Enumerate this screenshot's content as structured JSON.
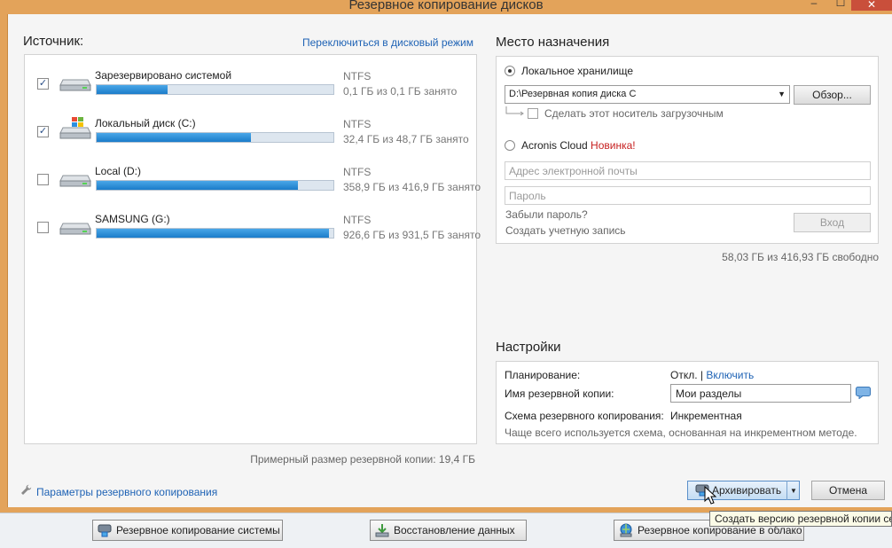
{
  "window": {
    "title": "Резервное копирование дисков",
    "min_glyph": "–",
    "max_glyph": "☐",
    "close_glyph": "✕"
  },
  "source": {
    "heading": "Источник:",
    "switch_link": "Переключиться в дисковый режим",
    "disks": [
      {
        "name": "Зарезервировано системой",
        "fs": "NTFS",
        "usage": "0,1 ГБ из 0,1 ГБ занято",
        "checked": true,
        "fill": 0.3,
        "icon": "hdd-icon"
      },
      {
        "name": "Локальный диск (C:)",
        "fs": "NTFS",
        "usage": "32,4 ГБ из 48,7 ГБ занято",
        "checked": true,
        "fill": 0.65,
        "icon": "windows-hdd-icon"
      },
      {
        "name": "Local (D:)",
        "fs": "NTFS",
        "usage": "358,9 ГБ из 416,9 ГБ занято",
        "checked": false,
        "fill": 0.85,
        "icon": "hdd-icon"
      },
      {
        "name": "SAMSUNG (G:)",
        "fs": "NTFS",
        "usage": "926,6 ГБ из 931,5 ГБ занято",
        "checked": false,
        "fill": 0.98,
        "icon": "hdd-icon"
      }
    ],
    "estimated_size": "Примерный размер резервной копии: 19,4 ГБ"
  },
  "destination": {
    "heading": "Место назначения",
    "local_label": "Локальное хранилище",
    "path_value": "D:\\Резервная копия диска C",
    "browse_label": "Обзор...",
    "bootable_label": "Сделать этот носитель загрузочным",
    "cloud_label": "Acronis Cloud",
    "cloud_badge": "Новинка!",
    "email_placeholder": "Адрес электронной почты",
    "password_placeholder": "Пароль",
    "forgot_password": "Забыли пароль?",
    "create_account": "Создать учетную запись",
    "login_label": "Вход",
    "free_space": "58,03 ГБ из 416,93 ГБ свободно"
  },
  "settings": {
    "heading": "Настройки",
    "schedule_label": "Планирование:",
    "schedule_value": "Откл.",
    "schedule_sep": "|",
    "schedule_enable": "Включить",
    "name_label": "Имя резервной копии:",
    "name_value": "Мои разделы",
    "scheme_label": "Схема резервного копирования:",
    "scheme_value": "Инкрементная",
    "scheme_hint": "Чаще всего используется схема, основанная на инкрементном методе."
  },
  "footer": {
    "params_link": "Параметры резервного копирования",
    "archive_label": "Архивировать",
    "cancel_label": "Отмена",
    "tooltip": "Создать версию резервной копии се"
  },
  "bottom_bar": {
    "system_backup": "Резервное копирование системы",
    "restore": "Восстановление данных",
    "cloud_backup": "Резервное копирование в облако"
  }
}
